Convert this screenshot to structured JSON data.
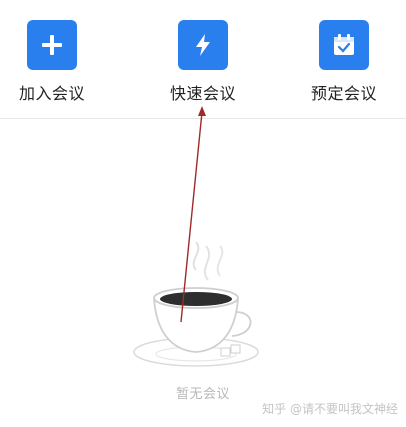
{
  "actions": [
    {
      "label": "加入会议",
      "icon": "plus-icon"
    },
    {
      "label": "快速会议",
      "icon": "lightning-icon"
    },
    {
      "label": "预定会议",
      "icon": "calendar-check-icon"
    }
  ],
  "empty_state": {
    "text": "暂无会议",
    "illustration": "coffee-cup-icon"
  },
  "watermark": "知乎 @请不要叫我文神经",
  "colors": {
    "accent": "#2a7fef",
    "arrow": "#a12a2a",
    "muted": "#b8b8b8"
  }
}
